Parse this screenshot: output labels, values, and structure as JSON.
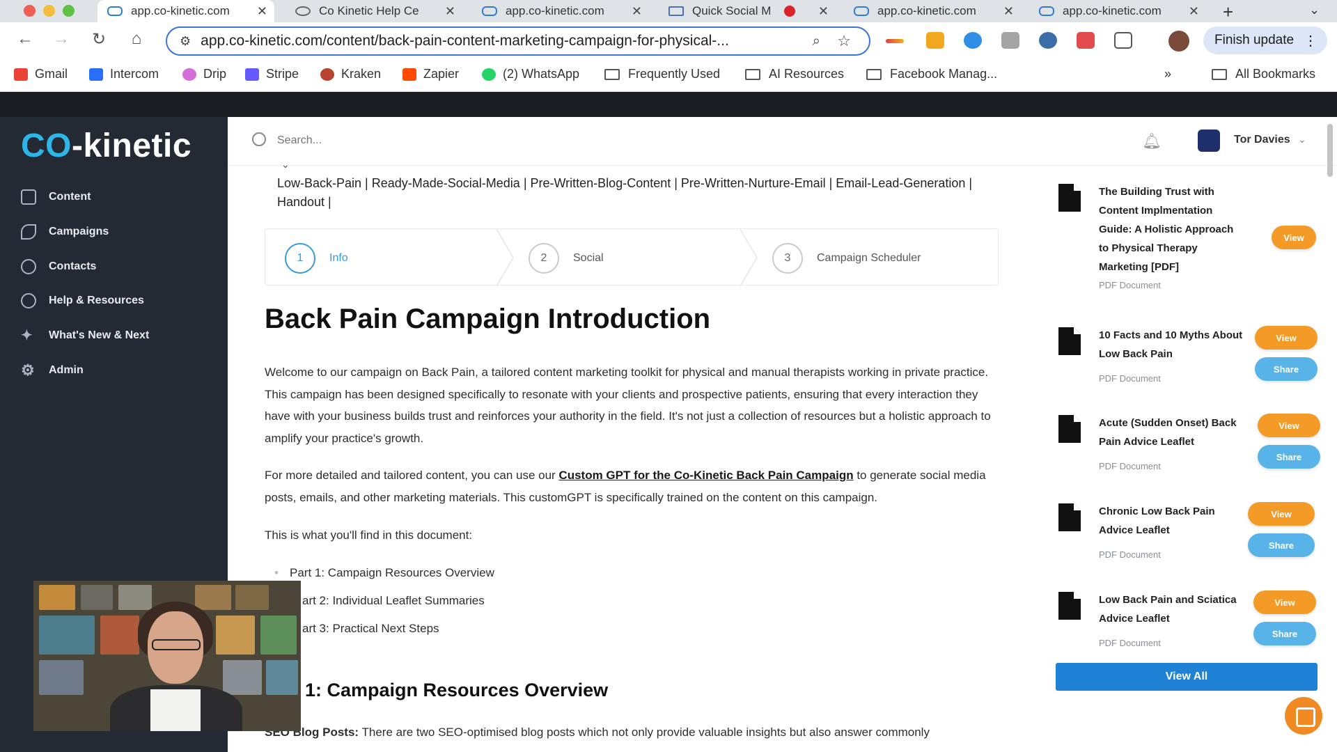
{
  "browser": {
    "tabs": [
      {
        "title": "app.co-kinetic.com",
        "icon": "co-kinetic-logo",
        "active": true
      },
      {
        "title": "Co Kinetic Help Ce",
        "icon": "help-center-icon",
        "active": false
      },
      {
        "title": "app.co-kinetic.com",
        "icon": "co-kinetic-logo",
        "active": false
      },
      {
        "title": "Quick Social M",
        "icon": "doc-icon",
        "active": false
      },
      {
        "title": "app.co-kinetic.com",
        "icon": "co-kinetic-logo",
        "active": false
      },
      {
        "title": "app.co-kinetic.com",
        "icon": "co-kinetic-logo",
        "active": false
      }
    ],
    "url": "app.co-kinetic.com/content/back-pain-content-marketing-campaign-for-physical-...",
    "finish_update": "Finish update",
    "bookmarks": [
      "Gmail",
      "Intercom",
      "Drip",
      "Stripe",
      "Kraken",
      "Zapier",
      "(2) WhatsApp",
      "Frequently Used",
      "AI Resources",
      "Facebook Manag...",
      "All Bookmarks"
    ]
  },
  "app": {
    "logo_co": "CO",
    "logo_rest": "-kinetic",
    "nav": [
      "Content",
      "Campaigns",
      "Contacts",
      "Help & Resources",
      "What's New & Next",
      "Admin"
    ],
    "search_placeholder": "Search...",
    "user_name": "Tor Davies"
  },
  "content": {
    "tags": "Low-Back-Pain | Ready-Made-Social-Media | Pre-Written-Blog-Content | Pre-Written-Nurture-Email | Email-Lead-Generation | Handout |",
    "steps": [
      {
        "num": "1",
        "label": "Info"
      },
      {
        "num": "2",
        "label": "Social"
      },
      {
        "num": "3",
        "label": "Campaign Scheduler"
      }
    ],
    "title": "Back Pain Campaign Introduction",
    "intro": "Welcome to our campaign on Back Pain, a tailored content marketing toolkit for physical and manual therapists working in private practice. This campaign has been designed specifically to resonate with your clients and prospective patients, ensuring that every interaction they have with your business builds trust and reinforces your authority in the field. It's not just a collection of resources but a holistic approach to amplify your practice's growth.",
    "gpt_prefix": "For more detailed and tailored content, you can use our ",
    "gpt_link": "Custom GPT for the Co-Kinetic Back Pain Campaign",
    "gpt_suffix": " to generate social media posts, emails, and other marketing materials. This customGPT is specifically trained on the content on this campaign.",
    "find_intro": "This is what you'll find in this document:",
    "parts": [
      "Part 1: Campaign Resources Overview",
      "art 2: Individual Leaflet Summaries",
      "art 3: Practical Next Steps"
    ],
    "section_title": "1: Campaign Resources Overview",
    "seo_label": "SEO Blog Posts:",
    "seo_text": " There are two SEO-optimised blog posts which not only provide valuable insights but also answer commonly"
  },
  "resources": {
    "items": [
      {
        "title": "The Building Trust with Content Implmentation Guide: A Holistic Approach to Physical Therapy Marketing [PDF]",
        "type": "PDF Document",
        "view": "View",
        "share": ""
      },
      {
        "title": "10 Facts and 10 Myths About Low Back Pain",
        "type": "PDF Document",
        "view": "View",
        "share": "Share"
      },
      {
        "title": "Acute (Sudden Onset) Back Pain Advice Leaflet",
        "type": "PDF Document",
        "view": "View",
        "share": "Share"
      },
      {
        "title": "Chronic Low Back Pain Advice Leaflet",
        "type": "PDF Document",
        "view": "View",
        "share": "Share"
      },
      {
        "title": "Low Back Pain and Sciatica Advice Leaflet",
        "type": "PDF Document",
        "view": "View",
        "share": "Share"
      }
    ],
    "view_all": "View All"
  },
  "colors": {
    "sidebar": "#242a33",
    "accent_blue": "#1f82d4",
    "view_orange": "#f39a27",
    "share_blue": "#58b4e8",
    "logo_cyan": "#2fb6e8"
  }
}
